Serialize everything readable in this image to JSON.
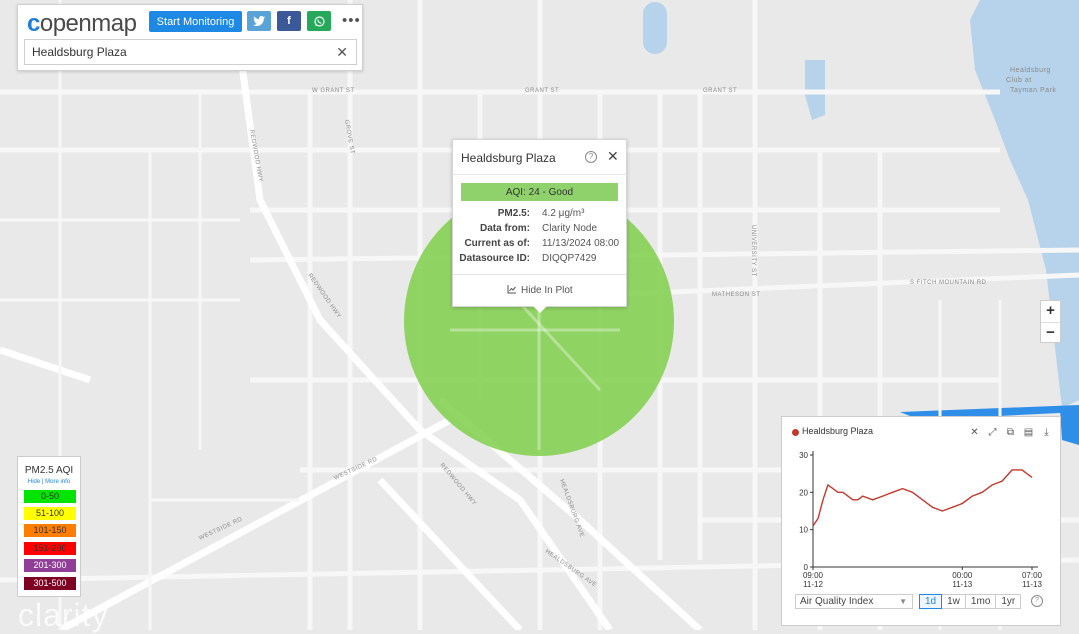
{
  "app": {
    "logo_text": "openmap",
    "logo_mark": "c"
  },
  "toolbar": {
    "start_monitoring_label": "Start Monitoring",
    "twitter_icon": "twitter-icon",
    "facebook_icon": "facebook-icon",
    "whatsapp_icon": "whatsapp-icon",
    "more_label": "•••"
  },
  "search": {
    "value": "Healdsburg Plaza",
    "clear_label": "✕"
  },
  "map": {
    "streets": [
      "W GRANT ST",
      "GRANT ST",
      "GRANT ST",
      "REDWOOD HWY",
      "GROVE ST",
      "REDWOOD HWY",
      "MATHESON ST",
      "S FITCH MOUNTAIN RD",
      "UNIVERSITY ST",
      "WESTSIDE RD",
      "WESTSIDE RD",
      "REDWOOD HWY",
      "HEALDSBURG AVE",
      "HEALDSBURG AVE"
    ],
    "poi_label": "Healdsburg Club at Tayman Park",
    "aqi_circle_color": "#7fcf4a"
  },
  "popup": {
    "title": "Healdsburg Plaza",
    "aqi_text": "AQI: 24 - Good",
    "aqi_color": "#8fd16b",
    "rows": [
      {
        "label": "PM2.5:",
        "value": "4.2 μg/m³"
      },
      {
        "label": "Data from:",
        "value": "Clarity Node"
      },
      {
        "label": "Current as of:",
        "value": "11/13/2024 08:00"
      },
      {
        "label": "Datasource ID:",
        "value": "DIQQP7429"
      }
    ],
    "hide_in_plot_label": "Hide In Plot"
  },
  "zoom": {
    "in_label": "+",
    "out_label": "−"
  },
  "legend": {
    "title": "PM2.5 AQI",
    "hide_link": "Hide",
    "more_info_link": "More info",
    "items": [
      {
        "label": "0-50",
        "color": "#00e400",
        "text_color": "#333333"
      },
      {
        "label": "51-100",
        "color": "#ffff00",
        "text_color": "#333333"
      },
      {
        "label": "101-150",
        "color": "#ff7e00",
        "text_color": "#333333"
      },
      {
        "label": "151-200",
        "color": "#ff0000",
        "text_color": "#333333"
      },
      {
        "label": "201-300",
        "color": "#8f3f97",
        "text_color": "#ffffff"
      },
      {
        "label": "301-500",
        "color": "#7e0023",
        "text_color": "#ffffff"
      }
    ]
  },
  "watermark": "clarity",
  "chart_panel": {
    "title": "Healdsburg Plaza",
    "metric_select": "Air Quality Index",
    "ranges": [
      "1d",
      "1w",
      "1mo",
      "1yr"
    ],
    "active_range": "1d"
  },
  "chart_data": {
    "type": "line",
    "title": "Healdsburg Plaza",
    "ylim": [
      0,
      30
    ],
    "yticks": [
      0,
      10,
      20,
      30
    ],
    "xlim": [
      9,
      31
    ],
    "xticks": [
      {
        "x": 9,
        "time": "09:00",
        "date": "11-12"
      },
      {
        "x": 24,
        "time": "00:00",
        "date": "11-13"
      },
      {
        "x": 31,
        "time": "07:00",
        "date": "11-13"
      }
    ],
    "series": [
      {
        "color": "#c0392b",
        "x": [
          9,
          9.5,
          10,
          10.5,
          11,
          11.5,
          12,
          13,
          13.5,
          14,
          15,
          16,
          17,
          18,
          19,
          20,
          21,
          22,
          23,
          24,
          25,
          26,
          27,
          28,
          29,
          30,
          30.5,
          31
        ],
        "y": [
          11,
          13,
          18,
          22,
          21,
          20,
          20,
          18,
          18,
          19,
          18,
          19,
          20,
          21,
          20,
          18,
          16,
          15,
          16,
          17,
          19,
          20,
          22,
          23,
          26,
          26,
          25,
          24
        ]
      }
    ]
  }
}
